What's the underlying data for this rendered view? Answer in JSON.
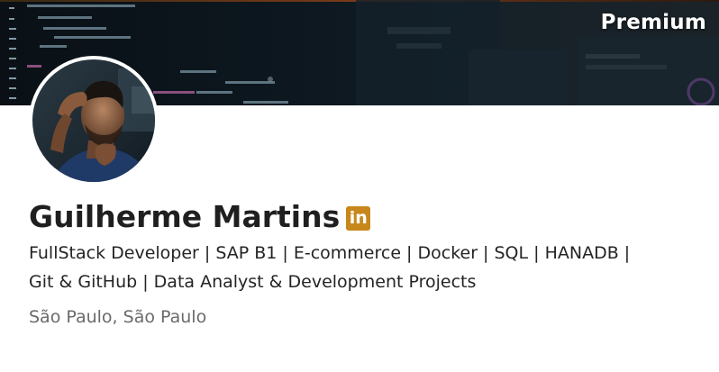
{
  "banner": {
    "badge": "Premium",
    "code_lines": [
      "});",
      "return convert(items);",
      "function () {",
      "return count(threshold_setting)",
      "});",
      "",
      "",
      "fetchData",
      "",
      "",
      "",
      "sync_items_(signature)"
    ],
    "line_numbers": [
      "9",
      "10",
      "11",
      "12",
      "13",
      "14",
      "15",
      "16",
      "17",
      "18",
      "19",
      "20"
    ]
  },
  "profile": {
    "name": "Guilherme Martins",
    "badge_icon": "linkedin-icon",
    "badge_text": "in",
    "badge_color": "#c7871a",
    "headline_line1": "FullStack Developer | SAP B1 | E-commerce | Docker | SQL | HANADB |",
    "headline_line2": "Git & GitHub | Data Analyst & Development Projects",
    "location": "São Paulo, São Paulo"
  }
}
